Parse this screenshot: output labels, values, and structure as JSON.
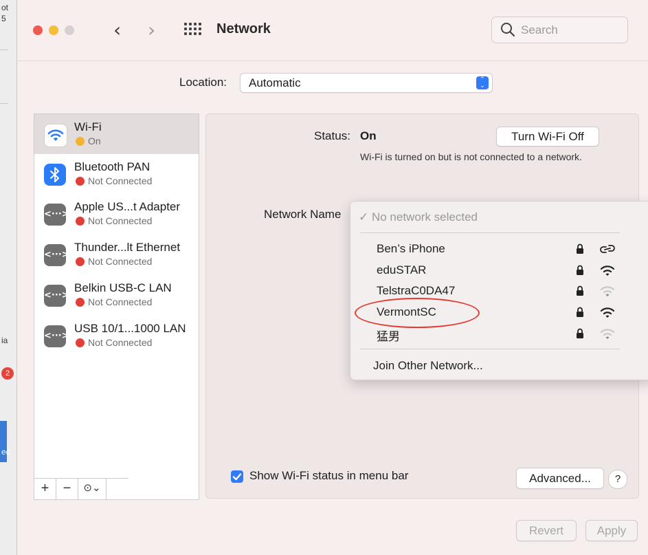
{
  "edge": {
    "texts": [
      "ot",
      "5",
      "ia",
      "ec"
    ],
    "badge": "2"
  },
  "window": {
    "title": "Network",
    "search_placeholder": "Search",
    "location_label": "Location:",
    "location_value": "Automatic"
  },
  "services": [
    {
      "name": "Wi-Fi",
      "status": "On",
      "status_color": "#f2b430",
      "icon": "wifi-icon",
      "selected": true
    },
    {
      "name": "Bluetooth PAN",
      "status": "Not Connected",
      "status_color": "#e23f38",
      "icon": "bluetooth-icon"
    },
    {
      "name": "Apple US...t Adapter",
      "status": "Not Connected",
      "status_color": "#e23f38",
      "icon": "ethernet-icon"
    },
    {
      "name": "Thunder...lt Ethernet",
      "status": "Not Connected",
      "status_color": "#e23f38",
      "icon": "ethernet-icon"
    },
    {
      "name": "Belkin USB-C LAN",
      "status": "Not Connected",
      "status_color": "#e23f38",
      "icon": "ethernet-icon"
    },
    {
      "name": "USB 10/1...1000 LAN",
      "status": "Not Connected",
      "status_color": "#e23f38",
      "icon": "ethernet-icon"
    }
  ],
  "ethernet_glyph": "<···>",
  "sidebar_toolbar": {
    "add": "+",
    "remove": "−",
    "action": "⊙⌄"
  },
  "detail": {
    "status_label": "Status:",
    "status_value": "On",
    "turn_off_button": "Turn Wi-Fi Off",
    "status_description": "Wi-Fi is turned on but is not connected to a network.",
    "network_name_label": "Network Name",
    "show_status_label": "Show Wi-Fi status in menu bar",
    "show_status_checked": true,
    "advanced_button": "Advanced...",
    "help_button": "?"
  },
  "dropdown": {
    "no_selection": "✓ No network selected",
    "networks": [
      {
        "ssid": "Ben’s iPhone",
        "locked": true,
        "signal": "hotspot-icon"
      },
      {
        "ssid": "eduSTAR",
        "locked": true,
        "signal": "wifi-strong-icon"
      },
      {
        "ssid": "TelstraC0DA47",
        "locked": true,
        "signal": "wifi-weak-icon"
      },
      {
        "ssid": "VermontSC",
        "locked": true,
        "signal": "wifi-strong-icon",
        "highlighted": true
      },
      {
        "ssid": "猛男",
        "locked": true,
        "signal": "wifi-weak-icon"
      }
    ],
    "join_other": "Join Other Network..."
  },
  "footer": {
    "revert_button": "Revert",
    "apply_button": "Apply"
  },
  "colors": {
    "accent": "#2f7cf6",
    "highlight_circle": "#e03a32"
  }
}
